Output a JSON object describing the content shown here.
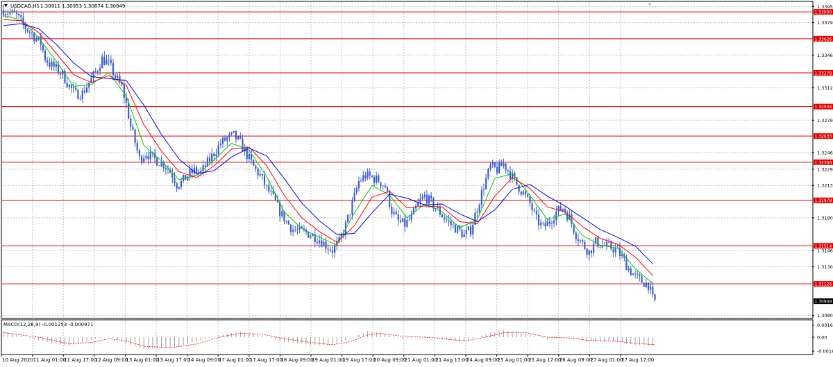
{
  "header": {
    "symbol_label": "USDCAD,H1",
    "ohlc": "1.30911 1.30953 1.30874 1.30949"
  },
  "macd_label": "MACD(12,26,9) -0.001253 -0.000971",
  "colors": {
    "background": "#ffffff",
    "border": "#000000",
    "grid": "#c0c0c0",
    "candle": "#3a5fcd",
    "level_line": "#e60000",
    "level_badge": "#e60000",
    "current_badge": "#000000",
    "ma_fast": "#00cc00",
    "ma_mid": "#ff0000",
    "ma_slow": "#0000ff",
    "macd_hist": "#a0a0a0",
    "macd_signal": "#ff0000"
  },
  "chart_data": [
    {
      "type": "line",
      "chart_style": "candlestick",
      "symbol": "USDCAD",
      "timeframe": "H1",
      "ylim": [
        1.3078,
        1.34
      ],
      "y_ticks": [
        "1.33955",
        "1.33790",
        "1.33460",
        "1.33125",
        "1.32795",
        "1.32465",
        "1.32295",
        "1.32130",
        "1.31800",
        "1.31465",
        "1.31300",
        "1.30805"
      ],
      "y_tick_values": [
        1.33955,
        1.3379,
        1.3346,
        1.33125,
        1.32795,
        1.32465,
        1.32295,
        1.3213,
        1.318,
        1.31465,
        1.313,
        1.30805
      ],
      "x_ticks": [
        "10 Aug 2020",
        "11 Aug 01:00",
        "11 Aug 17:00",
        "12 Aug 09:00",
        "13 Aug 01:00",
        "13 Aug 17:00",
        "14 Aug 09:00",
        "17 Aug 01:00",
        "17 Aug 17:00",
        "18 Aug 09:00",
        "19 Aug 01:00",
        "19 Aug 17:00",
        "20 Aug 09:00",
        "21 Aug 01:00",
        "21 Aug 17:00",
        "24 Aug 09:00",
        "25 Aug 01:00",
        "25 Aug 17:00",
        "26 Aug 09:00",
        "27 Aug 01:00",
        "27 Aug 17:00"
      ],
      "levels": [
        "1.33900",
        "1.33626",
        "1.33278",
        "1.32934",
        "1.32633",
        "1.32366",
        "1.31978",
        "1.31514",
        "1.31126"
      ],
      "current_price": "1.30949",
      "price_path": [
        [
          0,
          1.3392
        ],
        [
          6,
          1.3386
        ],
        [
          10,
          1.3374
        ],
        [
          14,
          1.3365
        ],
        [
          17,
          1.3358
        ],
        [
          19,
          1.3343
        ],
        [
          21,
          1.3337
        ],
        [
          24,
          1.3332
        ],
        [
          27,
          1.3326
        ],
        [
          30,
          1.3314
        ],
        [
          33,
          1.3306
        ],
        [
          36,
          1.3307
        ],
        [
          39,
          1.3318
        ],
        [
          42,
          1.3328
        ],
        [
          45,
          1.3342
        ],
        [
          48,
          1.3337
        ],
        [
          51,
          1.3324
        ],
        [
          54,
          1.3313
        ],
        [
          56,
          1.3296
        ],
        [
          58,
          1.3273
        ],
        [
          60,
          1.3257
        ],
        [
          62,
          1.324
        ],
        [
          65,
          1.3246
        ],
        [
          68,
          1.3241
        ],
        [
          71,
          1.3237
        ],
        [
          73,
          1.3235
        ],
        [
          75,
          1.323
        ],
        [
          77,
          1.3224
        ],
        [
          79,
          1.3214
        ],
        [
          81,
          1.3216
        ],
        [
          84,
          1.3223
        ],
        [
          87,
          1.3228
        ],
        [
          90,
          1.3226
        ],
        [
          93,
          1.3236
        ],
        [
          96,
          1.3246
        ],
        [
          99,
          1.3256
        ],
        [
          102,
          1.3261
        ],
        [
          105,
          1.3264
        ],
        [
          108,
          1.3256
        ],
        [
          111,
          1.3244
        ],
        [
          114,
          1.3232
        ],
        [
          117,
          1.3223
        ],
        [
          120,
          1.321
        ],
        [
          123,
          1.32
        ],
        [
          126,
          1.3186
        ],
        [
          129,
          1.3176
        ],
        [
          132,
          1.3168
        ],
        [
          135,
          1.3166
        ],
        [
          138,
          1.3165
        ],
        [
          141,
          1.3162
        ],
        [
          144,
          1.3158
        ],
        [
          147,
          1.3152
        ],
        [
          150,
          1.3147
        ],
        [
          153,
          1.3155
        ],
        [
          156,
          1.3172
        ],
        [
          159,
          1.3194
        ],
        [
          162,
          1.3217
        ],
        [
          165,
          1.3223
        ],
        [
          168,
          1.3221
        ],
        [
          171,
          1.3218
        ],
        [
          174,
          1.3212
        ],
        [
          177,
          1.3187
        ],
        [
          180,
          1.3176
        ],
        [
          183,
          1.3173
        ],
        [
          186,
          1.318
        ],
        [
          189,
          1.3194
        ],
        [
          192,
          1.3202
        ],
        [
          195,
          1.3195
        ],
        [
          198,
          1.3188
        ],
        [
          201,
          1.318
        ],
        [
          204,
          1.3173
        ],
        [
          207,
          1.3168
        ],
        [
          210,
          1.3162
        ],
        [
          213,
          1.3168
        ],
        [
          216,
          1.319
        ],
        [
          219,
          1.3213
        ],
        [
          222,
          1.3232
        ],
        [
          225,
          1.3229
        ],
        [
          228,
          1.3235
        ],
        [
          231,
          1.3225
        ],
        [
          234,
          1.3214
        ],
        [
          237,
          1.3205
        ],
        [
          240,
          1.3194
        ],
        [
          243,
          1.3178
        ],
        [
          246,
          1.317
        ],
        [
          249,
          1.3176
        ],
        [
          252,
          1.3186
        ],
        [
          255,
          1.319
        ],
        [
          258,
          1.318
        ],
        [
          261,
          1.3163
        ],
        [
          264,
          1.3153
        ],
        [
          267,
          1.3145
        ],
        [
          270,
          1.3155
        ],
        [
          273,
          1.3152
        ],
        [
          276,
          1.315
        ],
        [
          279,
          1.3148
        ],
        [
          282,
          1.314
        ],
        [
          285,
          1.3128
        ],
        [
          288,
          1.312
        ],
        [
          291,
          1.3115
        ],
        [
          294,
          1.3112
        ],
        [
          296,
          1.3097
        ],
        [
          297,
          1.3095
        ]
      ],
      "moving_averages": [
        {
          "color": "#00cc00",
          "points": [
            [
              0,
              1.3386
            ],
            [
              8,
              1.3382
            ],
            [
              16,
              1.3364
            ],
            [
              24,
              1.334
            ],
            [
              32,
              1.3314
            ],
            [
              40,
              1.3316
            ],
            [
              48,
              1.3328
            ],
            [
              56,
              1.3304
            ],
            [
              64,
              1.3254
            ],
            [
              72,
              1.3238
            ],
            [
              80,
              1.3219
            ],
            [
              88,
              1.3223
            ],
            [
              96,
              1.3239
            ],
            [
              104,
              1.3256
            ],
            [
              112,
              1.3249
            ],
            [
              120,
              1.3222
            ],
            [
              128,
              1.3186
            ],
            [
              136,
              1.3169
            ],
            [
              144,
              1.316
            ],
            [
              152,
              1.3152
            ],
            [
              160,
              1.3185
            ],
            [
              168,
              1.3213
            ],
            [
              176,
              1.3203
            ],
            [
              184,
              1.318
            ],
            [
              192,
              1.3194
            ],
            [
              200,
              1.3186
            ],
            [
              208,
              1.317
            ],
            [
              216,
              1.3178
            ],
            [
              224,
              1.322
            ],
            [
              232,
              1.3225
            ],
            [
              240,
              1.3203
            ],
            [
              248,
              1.3178
            ],
            [
              256,
              1.3184
            ],
            [
              264,
              1.3162
            ],
            [
              272,
              1.3152
            ],
            [
              280,
              1.3149
            ],
            [
              288,
              1.3128
            ],
            [
              296,
              1.3113
            ]
          ]
        },
        {
          "color": "#ff0000",
          "points": [
            [
              0,
              1.3382
            ],
            [
              8,
              1.3381
            ],
            [
              16,
              1.3369
            ],
            [
              24,
              1.3348
            ],
            [
              32,
              1.3326
            ],
            [
              40,
              1.3318
            ],
            [
              48,
              1.3325
            ],
            [
              56,
              1.3315
            ],
            [
              64,
              1.3275
            ],
            [
              72,
              1.3248
            ],
            [
              80,
              1.3227
            ],
            [
              88,
              1.3221
            ],
            [
              96,
              1.3233
            ],
            [
              104,
              1.325
            ],
            [
              112,
              1.3252
            ],
            [
              120,
              1.3233
            ],
            [
              128,
              1.3203
            ],
            [
              136,
              1.318
            ],
            [
              144,
              1.3166
            ],
            [
              152,
              1.3155
            ],
            [
              160,
              1.3172
            ],
            [
              168,
              1.3201
            ],
            [
              176,
              1.3207
            ],
            [
              184,
              1.319
            ],
            [
              192,
              1.3192
            ],
            [
              200,
              1.3191
            ],
            [
              208,
              1.3176
            ],
            [
              216,
              1.3174
            ],
            [
              224,
              1.3202
            ],
            [
              232,
              1.3221
            ],
            [
              240,
              1.321
            ],
            [
              248,
              1.3191
            ],
            [
              256,
              1.3186
            ],
            [
              264,
              1.3171
            ],
            [
              272,
              1.3159
            ],
            [
              280,
              1.3153
            ],
            [
              288,
              1.314
            ],
            [
              296,
              1.3121
            ]
          ]
        },
        {
          "color": "#0000ff",
          "points": [
            [
              0,
              1.3376
            ],
            [
              8,
              1.3378
            ],
            [
              16,
              1.3373
            ],
            [
              24,
              1.3357
            ],
            [
              32,
              1.3338
            ],
            [
              40,
              1.3324
            ],
            [
              48,
              1.3322
            ],
            [
              56,
              1.332
            ],
            [
              64,
              1.3295
            ],
            [
              72,
              1.3265
            ],
            [
              80,
              1.324
            ],
            [
              88,
              1.3225
            ],
            [
              96,
              1.3228
            ],
            [
              104,
              1.3242
            ],
            [
              112,
              1.3251
            ],
            [
              120,
              1.3243
            ],
            [
              128,
              1.322
            ],
            [
              136,
              1.3195
            ],
            [
              144,
              1.3177
            ],
            [
              152,
              1.3163
            ],
            [
              160,
              1.3164
            ],
            [
              168,
              1.3185
            ],
            [
              176,
              1.3204
            ],
            [
              184,
              1.32
            ],
            [
              192,
              1.3193
            ],
            [
              200,
              1.3194
            ],
            [
              208,
              1.3184
            ],
            [
              216,
              1.3176
            ],
            [
              224,
              1.3188
            ],
            [
              232,
              1.3209
            ],
            [
              240,
              1.3214
            ],
            [
              248,
              1.3202
            ],
            [
              256,
              1.3192
            ],
            [
              264,
              1.318
            ],
            [
              272,
              1.3168
            ],
            [
              280,
              1.316
            ],
            [
              288,
              1.3151
            ],
            [
              296,
              1.3133
            ]
          ]
        }
      ]
    },
    {
      "type": "bar",
      "title": "MACD(12,26,9) -0.001253 -0.000971",
      "ylim": [
        -0.0022,
        0.0022
      ],
      "y_ticks": [
        "0.001602",
        "0.00",
        "-0.001845"
      ],
      "y_tick_values": [
        0.001602,
        0.0,
        -0.001845
      ],
      "histogram_points": [
        [
          0,
          0.0008
        ],
        [
          16,
          -0.0004
        ],
        [
          30,
          -0.0012
        ],
        [
          40,
          -0.0004
        ],
        [
          48,
          0.0001
        ],
        [
          56,
          -0.0008
        ],
        [
          64,
          -0.0016
        ],
        [
          76,
          -0.0014
        ],
        [
          88,
          -0.0006
        ],
        [
          100,
          0.0004
        ],
        [
          108,
          0.0007
        ],
        [
          118,
          0.0002
        ],
        [
          128,
          -0.0006
        ],
        [
          140,
          -0.001
        ],
        [
          150,
          -0.0011
        ],
        [
          158,
          -0.0002
        ],
        [
          166,
          0.0008
        ],
        [
          172,
          0.0006
        ],
        [
          182,
          -0.0002
        ],
        [
          192,
          0.0001
        ],
        [
          200,
          -0.0003
        ],
        [
          210,
          -0.0006
        ],
        [
          220,
          0.0004
        ],
        [
          228,
          0.0009
        ],
        [
          238,
          0.0005
        ],
        [
          248,
          -0.0003
        ],
        [
          258,
          0.0001
        ],
        [
          266,
          -0.0006
        ],
        [
          278,
          -0.0006
        ],
        [
          288,
          -0.001
        ],
        [
          297,
          -0.0012
        ]
      ],
      "signal_points": [
        [
          0,
          0.0006
        ],
        [
          16,
          0.0
        ],
        [
          30,
          -0.0009
        ],
        [
          40,
          -0.0007
        ],
        [
          48,
          -0.0002
        ],
        [
          56,
          -0.0005
        ],
        [
          64,
          -0.0012
        ],
        [
          76,
          -0.0014
        ],
        [
          88,
          -0.0009
        ],
        [
          100,
          0.0001
        ],
        [
          108,
          0.0005
        ],
        [
          118,
          0.0004
        ],
        [
          128,
          -0.0002
        ],
        [
          140,
          -0.0007
        ],
        [
          150,
          -0.001
        ],
        [
          158,
          -0.0006
        ],
        [
          166,
          0.0003
        ],
        [
          172,
          0.0005
        ],
        [
          182,
          0.0001
        ],
        [
          192,
          0.0
        ],
        [
          200,
          -0.0002
        ],
        [
          210,
          -0.0005
        ],
        [
          220,
          0.0
        ],
        [
          228,
          0.0006
        ],
        [
          238,
          0.0006
        ],
        [
          248,
          0.0
        ],
        [
          258,
          -0.0001
        ],
        [
          266,
          -0.0004
        ],
        [
          278,
          -0.0005
        ],
        [
          288,
          -0.0008
        ],
        [
          297,
          -0.001
        ]
      ]
    }
  ]
}
